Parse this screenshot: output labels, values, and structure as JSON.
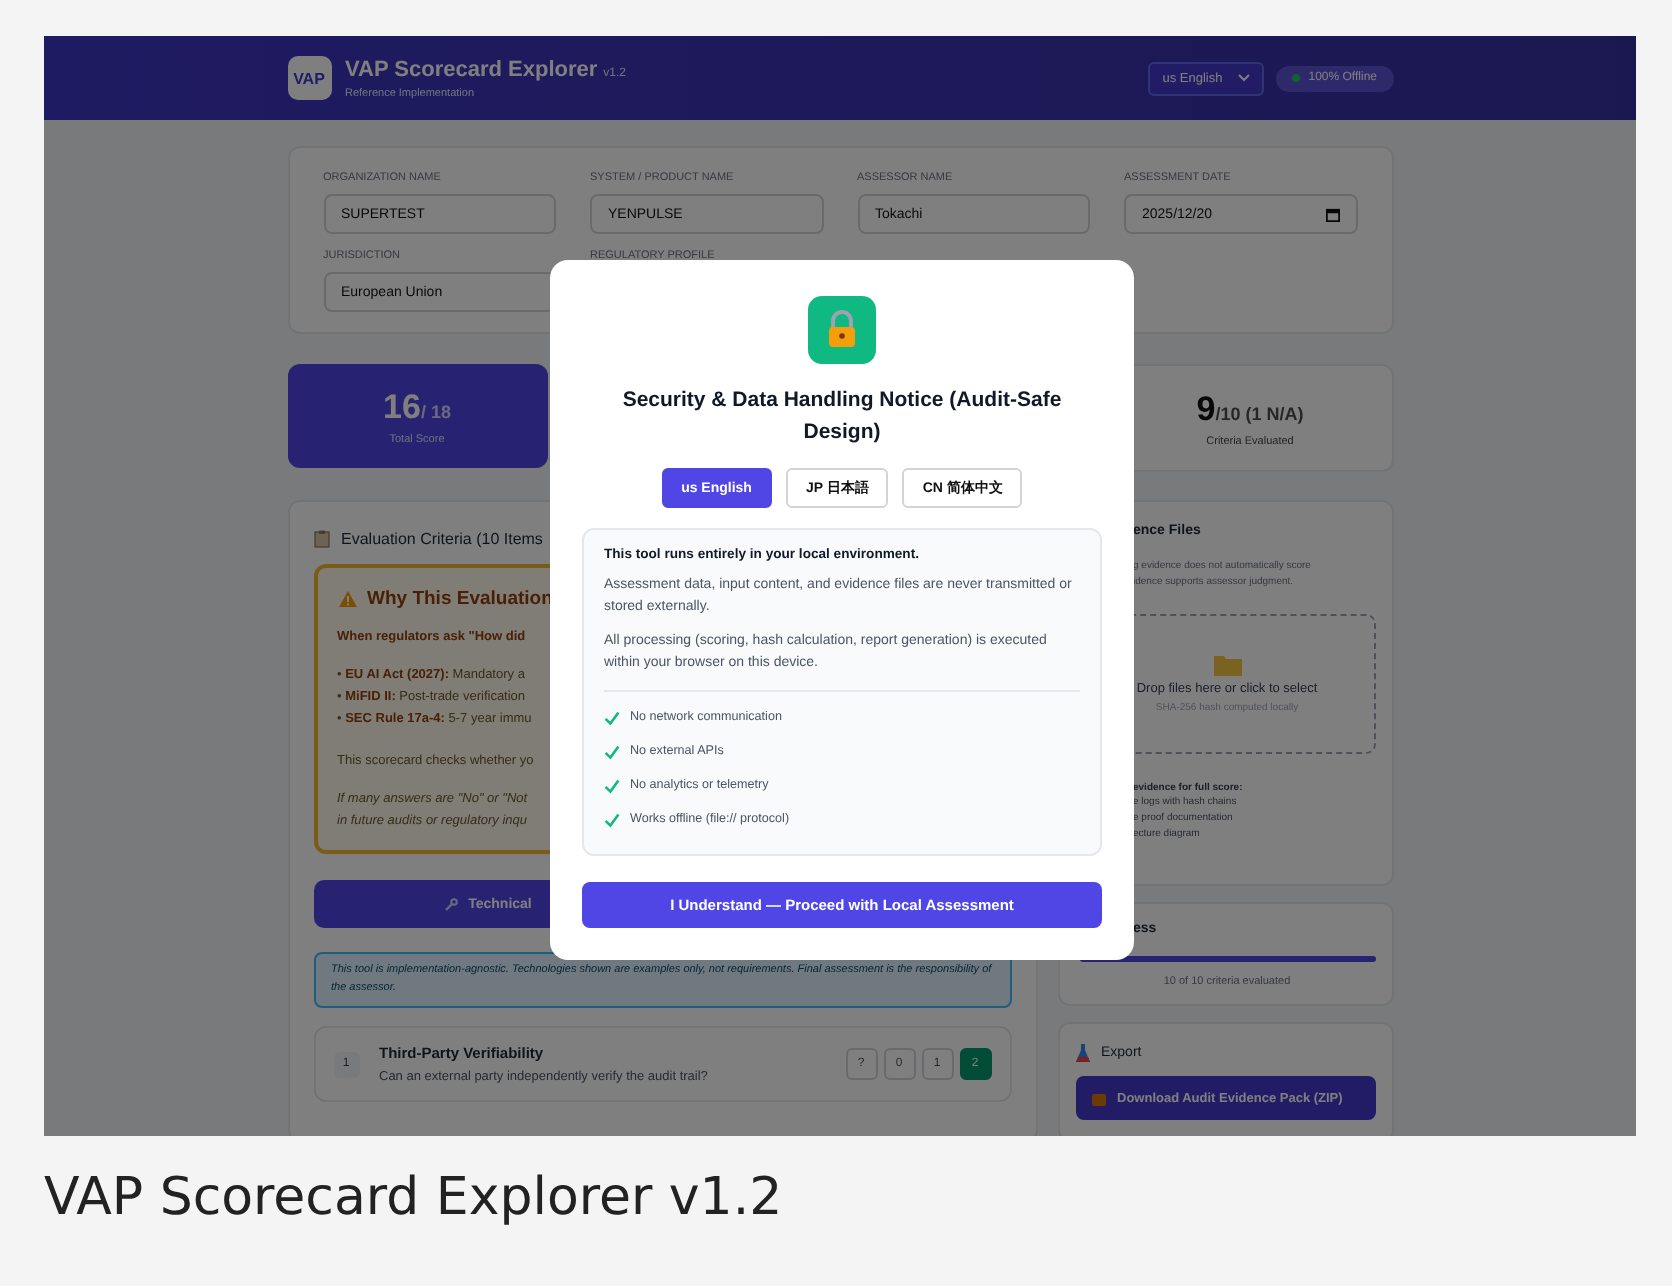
{
  "app": {
    "logo": "VAP",
    "title": "VAP Scorecard Explorer",
    "version": "v1.2",
    "subtitle": "Reference Implementation",
    "language": "us English",
    "status": "100% Offline"
  },
  "form": {
    "fields": [
      {
        "label": "ORGANIZATION NAME",
        "value": "SUPERTEST",
        "kind": "text"
      },
      {
        "label": "SYSTEM / PRODUCT NAME",
        "value": "YENPULSE",
        "kind": "text"
      },
      {
        "label": "ASSESSOR NAME",
        "value": "Tokachi",
        "kind": "text"
      },
      {
        "label": "ASSESSMENT DATE",
        "value": "2025/12/20",
        "kind": "date"
      },
      {
        "label": "JURISDICTION",
        "value": "European Union",
        "kind": "select"
      },
      {
        "label": "REGULATORY PROFILE",
        "kind": "hidden"
      }
    ]
  },
  "scores": [
    {
      "value": "16",
      "total": "/ 18",
      "label": "Total Score",
      "kind": "primary"
    },
    {
      "value": "9",
      "total": "/10 (1 N/A)",
      "label": "Criteria Evaluated",
      "kind": "plain"
    }
  ],
  "criteria": {
    "title": "Evaluation Criteria (10 Items",
    "warning": {
      "title": "Why This Evaluation",
      "lines": [
        {
          "kind": "lead",
          "text": "When regulators ask \"How did"
        },
        {
          "kind": "bullet",
          "text": "• **EU AI Act (2027):** Mandatory a"
        },
        {
          "kind": "bullet",
          "text": "• **MiFID II:** Post-trade verification"
        },
        {
          "kind": "bullet",
          "text": "• **SEC Rule 17a-4:** 5-7 year immu"
        },
        {
          "kind": "text",
          "text": "This scorecard checks whether yo"
        },
        {
          "kind": "italic",
          "text": "If many answers are \"No\" or \"Not"
        },
        {
          "kind": "italic",
          "text": "in future audits or regulatory inqu"
        }
      ]
    },
    "category_tabs": [
      {
        "label": "Technical",
        "selected": true
      }
    ],
    "note": "This tool is implementation-agnostic. Technologies shown are examples only, not requirements. Final assessment is the responsibility of the assessor.",
    "items": [
      {
        "number": "1",
        "title": "Third-Party Verifiability",
        "question": "Can an external party independently verify the audit trail?",
        "options": [
          {
            "label": "?",
            "selected": false
          },
          {
            "label": "0",
            "selected": false
          },
          {
            "label": "1",
            "selected": false
          },
          {
            "label": "2",
            "selected": true
          }
        ]
      }
    ]
  },
  "evidence": {
    "title": "ence Files",
    "note_lines": [
      "g evidence does not automatically score",
      "idence supports assessor judgment."
    ],
    "drop_text": "Drop files here or click to select",
    "drop_hint": "SHA-256 hash computed locally",
    "tips_title": "evidence for full score:",
    "tips": [
      "e logs with hash chains",
      "e proof documentation",
      "ecture diagram"
    ]
  },
  "progress": {
    "title": "ess",
    "level": 1,
    "reading": "10 of 10 criteria evaluated"
  },
  "export": {
    "title": "Export",
    "buttons": [
      {
        "label": "Download Audit Evidence Pack (ZIP)"
      }
    ]
  },
  "modal": {
    "title": "Security & Data Handling Notice (Audit-Safe Design)",
    "languages": [
      {
        "label": "us English",
        "selected": true
      },
      {
        "label": "JP 日本語",
        "selected": false
      },
      {
        "label": "CN 简体中文",
        "selected": false
      }
    ],
    "heading": "This tool runs entirely in your local environment.",
    "paragraphs": [
      "Assessment data, input content, and evidence files are never transmitted or stored externally.",
      "All processing (scoring, hash calculation, report generation) is executed within your browser on this device."
    ],
    "checks": [
      "No network communication",
      "No external APIs",
      "No analytics or telemetry",
      "Works offline (file:// protocol)"
    ],
    "button": "I Understand — Proceed with Local Assessment"
  },
  "caption": "VAP Scorecard Explorer v1.2"
}
